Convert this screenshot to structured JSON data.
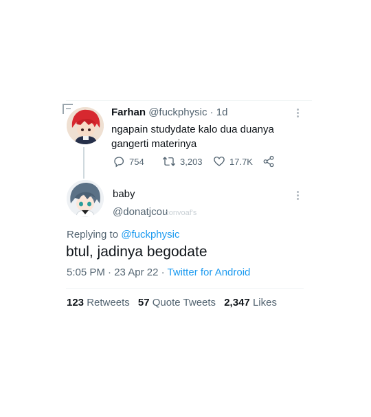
{
  "quoted": {
    "name": "Farhan",
    "handle": "@fuckphysic",
    "dot": "·",
    "age": "1d",
    "text_line1": "ngapain studydate kalo dua duanya",
    "text_line2": "gangerti materinya",
    "replies": "754",
    "retweets": "3,203",
    "likes": "17.7K"
  },
  "reply": {
    "name": "baby",
    "handle": "@donatjcou",
    "watermark": "convoaf's",
    "replying_prefix": "Replying to",
    "replying_to": "@fuckphysic",
    "text": "btul, jadinya begodate",
    "time": "5:05 PM",
    "date": "23 Apr 22",
    "dot": "·",
    "source": "Twitter for Android"
  },
  "stats": {
    "retweets_count": "123",
    "retweets_label": "Retweets",
    "quotes_count": "57",
    "quotes_label": "Quote Tweets",
    "likes_count": "2,347",
    "likes_label": "Likes"
  }
}
